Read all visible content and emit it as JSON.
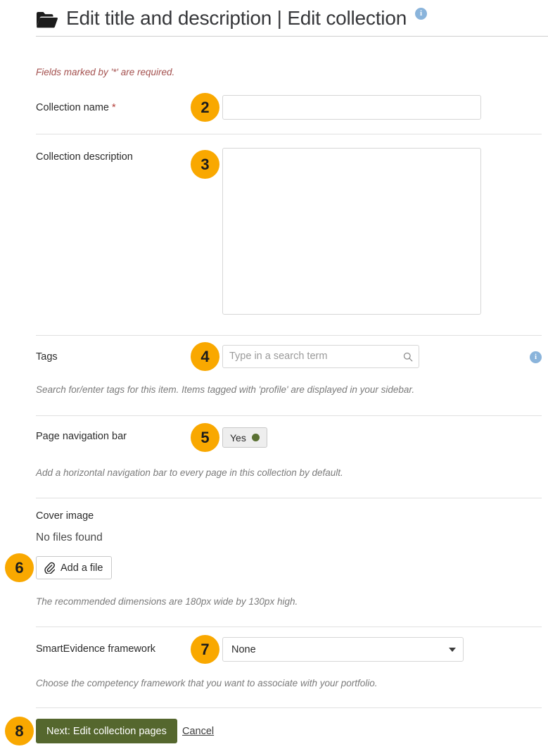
{
  "header": {
    "icon": "folder-icon",
    "title": "Edit title and description | Edit collection",
    "info_icon": "info-icon",
    "info_glyph": "i"
  },
  "form": {
    "required_note": "Fields marked by '*' are required.",
    "fields": {
      "collection_name": {
        "label": "Collection name",
        "required_marker": "*",
        "value": "",
        "placeholder": ""
      },
      "collection_description": {
        "label": "Collection description",
        "value": "",
        "placeholder": ""
      },
      "tags": {
        "label": "Tags",
        "value": "",
        "placeholder": "Type in a search term",
        "search_icon": "search-icon",
        "info_icon": "info-icon",
        "info_glyph": "i",
        "help": "Search for/enter tags for this item. Items tagged with 'profile' are displayed in your sidebar."
      },
      "page_navigation_bar": {
        "label": "Page navigation bar",
        "toggle_label": "Yes",
        "toggle_state": "on",
        "help": "Add a horizontal navigation bar to every page in this collection by default."
      },
      "cover_image": {
        "label": "Cover image",
        "status": "No files found",
        "button_label": "Add a file",
        "button_icon": "paperclip-icon",
        "help": "The recommended dimensions are 180px wide by 130px high."
      },
      "smartevidence_framework": {
        "label": "SmartEvidence framework",
        "value": "None",
        "caret_icon": "chevron-down-icon",
        "help": "Choose the competency framework that you want to associate with your portfolio."
      }
    }
  },
  "footer": {
    "submit_label": "Next: Edit collection pages",
    "cancel_label": "Cancel"
  },
  "step_badges": [
    {
      "number": "2"
    },
    {
      "number": "3"
    },
    {
      "number": "4"
    },
    {
      "number": "5"
    },
    {
      "number": "6"
    },
    {
      "number": "7"
    },
    {
      "number": "8"
    }
  ],
  "colors": {
    "badge": "#f9a800",
    "primary_button": "#55672e",
    "toggle_dot": "#5a7032",
    "info_icon": "#8ab4db",
    "required_text": "#a4514f"
  }
}
